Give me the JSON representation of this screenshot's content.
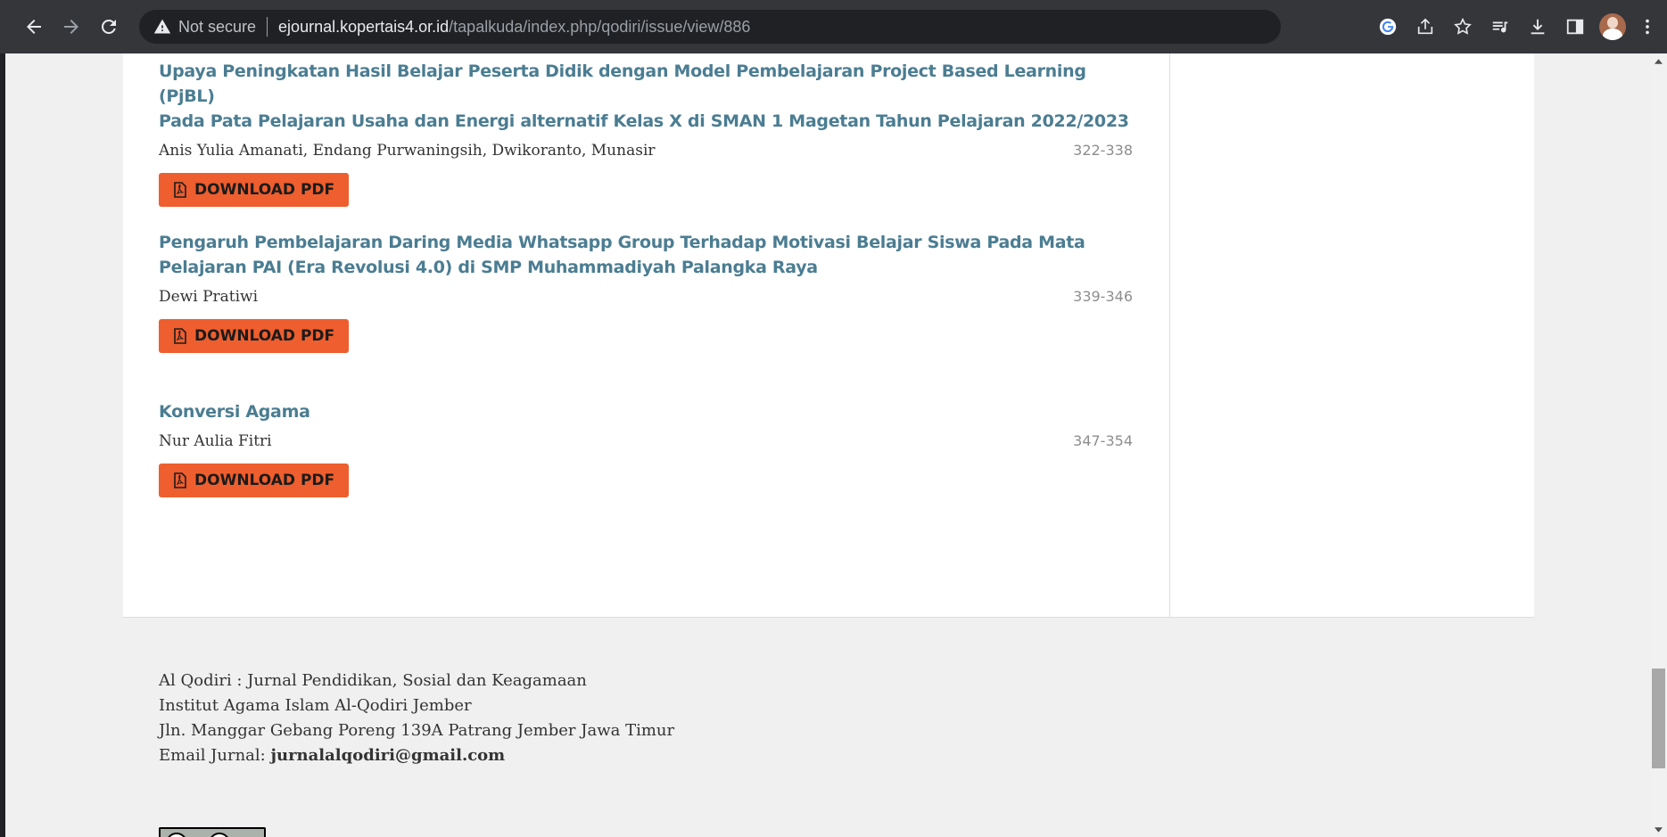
{
  "browser": {
    "not_secure": "Not secure",
    "url_host": "ejournal.kopertais4.or.id",
    "url_path": "/tapalkuda/index.php/qodiri/issue/view/886"
  },
  "articles": [
    {
      "title_line1": "Upaya Peningkatan Hasil Belajar Peserta Didik dengan Model Pembelajaran Project Based Learning (PjBL)",
      "title_line2": "Pada Pata Pelajaran Usaha dan Energi alternatif Kelas X di SMAN 1 Magetan Tahun Pelajaran 2022/2023",
      "authors": "Anis Yulia Amanati, Endang Purwaningsih, Dwikoranto, Munasir",
      "pages": "322-338",
      "button": "DOWNLOAD PDF"
    },
    {
      "title_line1": "Pengaruh Pembelajaran Daring Media Whatsapp Group Terhadap Motivasi Belajar Siswa Pada Mata",
      "title_line2": "Pelajaran PAI (Era Revolusi 4.0) di SMP Muhammadiyah Palangka Raya",
      "authors": "Dewi Pratiwi",
      "pages": "339-346",
      "button": "DOWNLOAD PDF"
    },
    {
      "title_line1": "Konversi Agama",
      "authors": "Nur Aulia Fitri",
      "pages": "347-354",
      "button": "DOWNLOAD PDF"
    }
  ],
  "footer": {
    "line1": "Al Qodiri : Jurnal Pendidikan, Sosial dan Keagamaan",
    "line2": "Institut Agama Islam Al-Qodiri Jember",
    "line3": "Jln. Manggar Gebang Poreng 139A Patrang Jember Jawa Timur",
    "email_label": "Email Jurnal: ",
    "email": "jurnalalqodiri@gmail.com"
  },
  "colors": {
    "title": "#4b7d92",
    "button": "#ee5e2e",
    "chrome": "#35363a"
  }
}
